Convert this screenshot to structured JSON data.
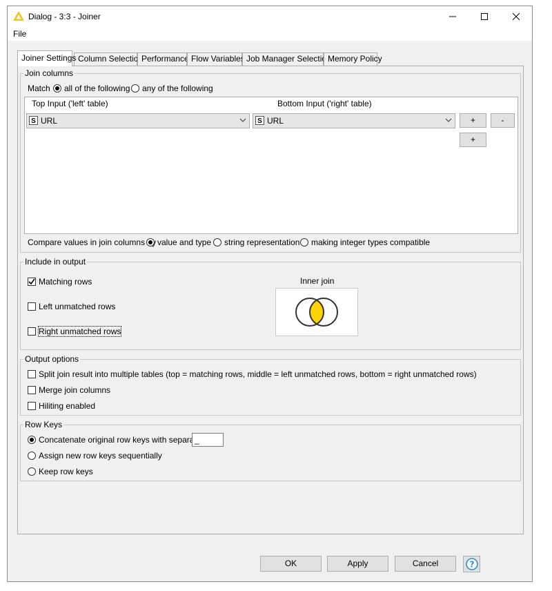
{
  "window": {
    "title": "Dialog - 3:3 - Joiner",
    "controls": [
      "minimize-icon",
      "maximize-icon",
      "close-icon"
    ]
  },
  "menu": {
    "file": "File"
  },
  "tabs": [
    {
      "label": "Joiner Settings",
      "active": true
    },
    {
      "label": "Column Selection",
      "active": false
    },
    {
      "label": "Performance",
      "active": false
    },
    {
      "label": "Flow Variables",
      "active": false
    },
    {
      "label": "Job Manager Selection",
      "active": false
    },
    {
      "label": "Memory Policy",
      "active": false
    }
  ],
  "join_columns": {
    "title": "Join columns",
    "match_label": "Match",
    "match_all": "all of the following",
    "match_any": "any of the following",
    "match_selected": "all",
    "top_header": "Top Input ('left' table)",
    "bottom_header": "Bottom Input ('right' table)",
    "row": {
      "left_type": "S",
      "left_value": "URL",
      "right_type": "S",
      "right_value": "URL"
    },
    "add_label": "+",
    "remove_label": "-",
    "add_label_2": "+",
    "compare_label": "Compare values in join columns by",
    "compare_options": [
      "value and type",
      "string representation",
      "making integer types compatible"
    ],
    "compare_selected": "value and type"
  },
  "include": {
    "title": "Include in output",
    "matching_rows": "Matching rows",
    "matching_checked": true,
    "left_unmatched": "Left unmatched rows",
    "left_checked": false,
    "right_unmatched": "Right unmatched rows",
    "right_checked": false,
    "join_type_label": "Inner join",
    "venn_fill": "#ffd200"
  },
  "output": {
    "title": "Output options",
    "split": "Split join result into multiple tables (top = matching rows, middle = left unmatched rows, bottom = right unmatched rows)",
    "merge": "Merge join columns",
    "hiliting": "Hiliting enabled"
  },
  "row_keys": {
    "title": "Row Keys",
    "concat": "Concatenate original row keys with separator",
    "separator_value": "_",
    "assign": "Assign new row keys sequentially",
    "keep": "Keep row keys",
    "selected": "concat"
  },
  "buttons": {
    "ok": "OK",
    "apply": "Apply",
    "cancel": "Cancel",
    "help_icon": "help-icon",
    "help_color": "#1e90d6"
  }
}
